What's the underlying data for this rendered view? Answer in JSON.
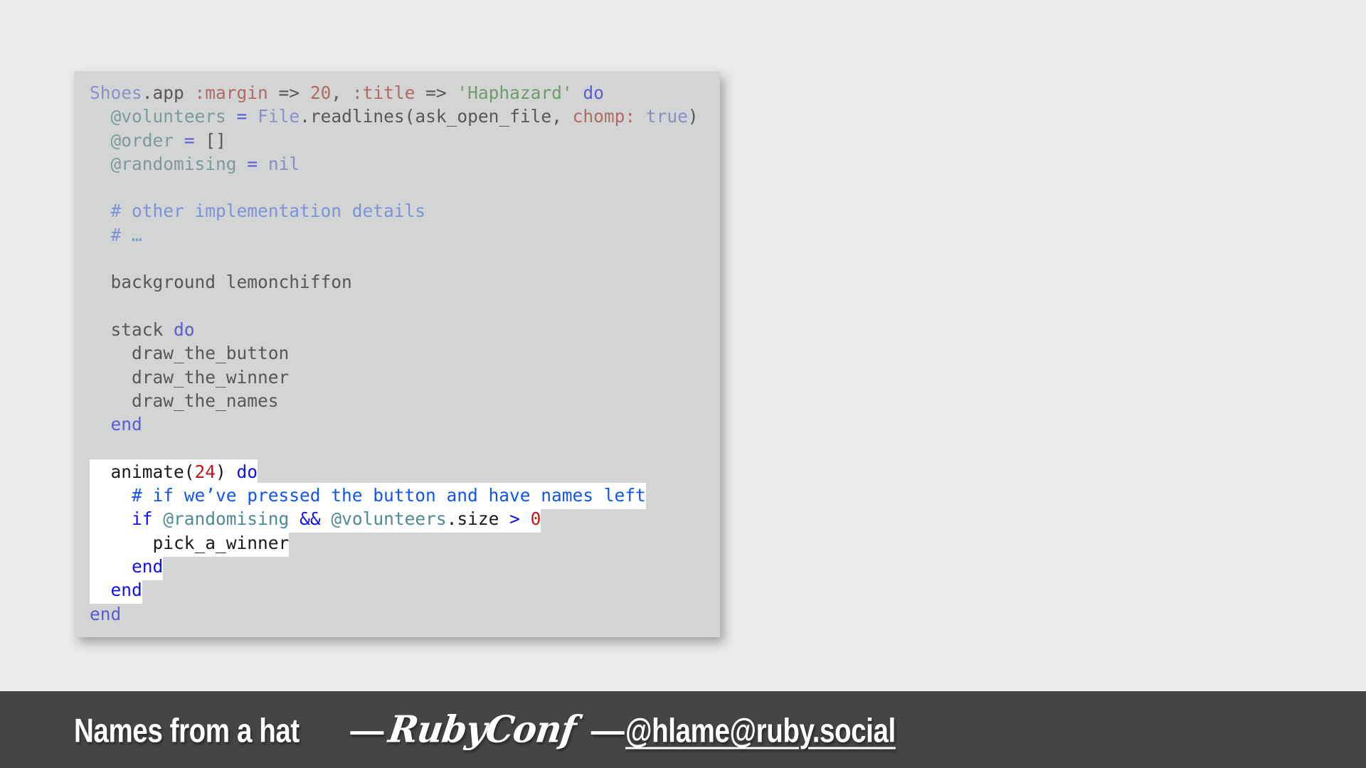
{
  "slide": {
    "background_color": "#ebebeb"
  },
  "code_panel": {
    "background_color": "#d3d4d4",
    "language": "ruby",
    "highlight_background": "#ffffff",
    "lines": [
      {
        "id": "l01",
        "highlighted": false,
        "text": "Shoes.app :margin => 20, :title => 'Haphazard' do"
      },
      {
        "id": "l02",
        "highlighted": false,
        "text": "  @volunteers = File.readlines(ask_open_file, chomp: true)"
      },
      {
        "id": "l03",
        "highlighted": false,
        "text": "  @order = []"
      },
      {
        "id": "l04",
        "highlighted": false,
        "text": "  @randomising = nil"
      },
      {
        "id": "l05",
        "highlighted": false,
        "text": ""
      },
      {
        "id": "l06",
        "highlighted": false,
        "text": "  # other implementation details"
      },
      {
        "id": "l07",
        "highlighted": false,
        "text": "  # …"
      },
      {
        "id": "l08",
        "highlighted": false,
        "text": ""
      },
      {
        "id": "l09",
        "highlighted": false,
        "text": "  background lemonchiffon"
      },
      {
        "id": "l10",
        "highlighted": false,
        "text": ""
      },
      {
        "id": "l11",
        "highlighted": false,
        "text": "  stack do"
      },
      {
        "id": "l12",
        "highlighted": false,
        "text": "    draw_the_button"
      },
      {
        "id": "l13",
        "highlighted": false,
        "text": "    draw_the_winner"
      },
      {
        "id": "l14",
        "highlighted": false,
        "text": "    draw_the_names"
      },
      {
        "id": "l15",
        "highlighted": false,
        "text": "  end"
      },
      {
        "id": "l16",
        "highlighted": false,
        "text": ""
      },
      {
        "id": "l17",
        "highlighted": true,
        "text": "  animate(24) do"
      },
      {
        "id": "l18",
        "highlighted": true,
        "text": "    # if we’ve pressed the button and have names left"
      },
      {
        "id": "l19",
        "highlighted": true,
        "text": "    if @randomising && @volunteers.size > 0"
      },
      {
        "id": "l20",
        "highlighted": true,
        "text": "      pick_a_winner"
      },
      {
        "id": "l21",
        "highlighted": true,
        "text": "    end"
      },
      {
        "id": "l22",
        "highlighted": true,
        "text": "  end"
      },
      {
        "id": "l23",
        "highlighted": false,
        "text": "end"
      }
    ],
    "tokens": {
      "l01": [
        {
          "t": "Shoes",
          "c": "const"
        },
        {
          "t": ".app ",
          "c": "plain"
        },
        {
          "t": ":margin",
          "c": "symbol"
        },
        {
          "t": " => ",
          "c": "plain"
        },
        {
          "t": "20",
          "c": "num"
        },
        {
          "t": ", ",
          "c": "plain"
        },
        {
          "t": ":title",
          "c": "symbol"
        },
        {
          "t": " => ",
          "c": "plain"
        },
        {
          "t": "'Haphazard'",
          "c": "string"
        },
        {
          "t": " ",
          "c": "plain"
        },
        {
          "t": "do",
          "c": "kw"
        }
      ],
      "l02": [
        {
          "t": "  ",
          "c": "plain"
        },
        {
          "t": "@volunteers",
          "c": "ivar"
        },
        {
          "t": " ",
          "c": "plain"
        },
        {
          "t": "=",
          "c": "op"
        },
        {
          "t": " ",
          "c": "plain"
        },
        {
          "t": "File",
          "c": "const"
        },
        {
          "t": ".readlines(ask_open_file, ",
          "c": "plain"
        },
        {
          "t": "chomp:",
          "c": "symbol"
        },
        {
          "t": " ",
          "c": "plain"
        },
        {
          "t": "true",
          "c": "nil"
        },
        {
          "t": ")",
          "c": "plain"
        }
      ],
      "l03": [
        {
          "t": "  ",
          "c": "plain"
        },
        {
          "t": "@order",
          "c": "ivar"
        },
        {
          "t": " ",
          "c": "plain"
        },
        {
          "t": "=",
          "c": "op"
        },
        {
          "t": " []",
          "c": "plain"
        }
      ],
      "l04": [
        {
          "t": "  ",
          "c": "plain"
        },
        {
          "t": "@randomising",
          "c": "ivar"
        },
        {
          "t": " ",
          "c": "plain"
        },
        {
          "t": "=",
          "c": "op"
        },
        {
          "t": " ",
          "c": "plain"
        },
        {
          "t": "nil",
          "c": "nil"
        }
      ],
      "l06": [
        {
          "t": "  ",
          "c": "plain"
        },
        {
          "t": "# other implementation details",
          "c": "comment"
        }
      ],
      "l07": [
        {
          "t": "  ",
          "c": "plain"
        },
        {
          "t": "# …",
          "c": "comment"
        }
      ],
      "l09": [
        {
          "t": "  background lemonchiffon",
          "c": "plain"
        }
      ],
      "l11": [
        {
          "t": "  stack ",
          "c": "plain"
        },
        {
          "t": "do",
          "c": "kw"
        }
      ],
      "l12": [
        {
          "t": "    draw_the_button",
          "c": "plain"
        }
      ],
      "l13": [
        {
          "t": "    draw_the_winner",
          "c": "plain"
        }
      ],
      "l14": [
        {
          "t": "    draw_the_names",
          "c": "plain"
        }
      ],
      "l15": [
        {
          "t": "  ",
          "c": "plain"
        },
        {
          "t": "end",
          "c": "kw"
        }
      ],
      "l17": [
        {
          "t": "  animate(",
          "c": "h-plain"
        },
        {
          "t": "24",
          "c": "h-num"
        },
        {
          "t": ") ",
          "c": "h-plain"
        },
        {
          "t": "do",
          "c": "h-kw"
        }
      ],
      "l18": [
        {
          "t": "    ",
          "c": "h-plain"
        },
        {
          "t": "# if we’ve pressed the button and have names left",
          "c": "h-comment"
        }
      ],
      "l19": [
        {
          "t": "    ",
          "c": "h-plain"
        },
        {
          "t": "if",
          "c": "h-kw"
        },
        {
          "t": " ",
          "c": "h-plain"
        },
        {
          "t": "@randomising",
          "c": "h-ivar"
        },
        {
          "t": " ",
          "c": "h-plain"
        },
        {
          "t": "&&",
          "c": "h-op"
        },
        {
          "t": " ",
          "c": "h-plain"
        },
        {
          "t": "@volunteers",
          "c": "h-ivar"
        },
        {
          "t": ".size ",
          "c": "h-plain"
        },
        {
          "t": ">",
          "c": "h-op"
        },
        {
          "t": " ",
          "c": "h-plain"
        },
        {
          "t": "0",
          "c": "h-num"
        }
      ],
      "l20": [
        {
          "t": "      pick_a_winner",
          "c": "h-plain"
        }
      ],
      "l21": [
        {
          "t": "    ",
          "c": "h-plain"
        },
        {
          "t": "end",
          "c": "h-kw"
        }
      ],
      "l22": [
        {
          "t": "  ",
          "c": "h-plain"
        },
        {
          "t": "end",
          "c": "h-kw"
        }
      ],
      "l23": [
        {
          "t": "end",
          "c": "kw"
        }
      ]
    }
  },
  "footer": {
    "background_color": "#454545",
    "text_color": "#ffffff",
    "title": "Names from a hat",
    "dash_1": "—",
    "brand": "RubyConf",
    "dash_2": "—",
    "handle": "@hlame@ruby.social"
  }
}
